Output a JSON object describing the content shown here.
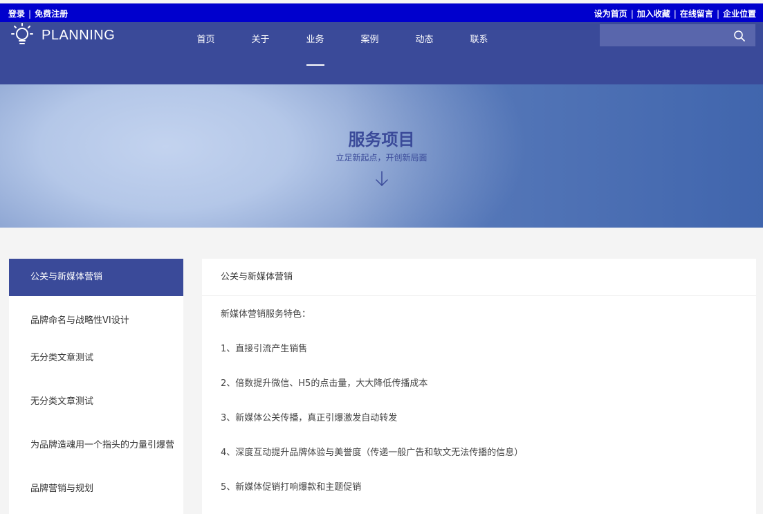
{
  "topbar": {
    "login": "登录",
    "register": "免费注册",
    "set_home": "设为首页",
    "add_fav": "加入收藏",
    "online_msg": "在线留言",
    "location": "企业位置",
    "separator": "|"
  },
  "header": {
    "logo_text": "PLANNING",
    "nav": [
      "首页",
      "关于",
      "业务",
      "案例",
      "动态",
      "联系"
    ],
    "active_nav": "业务",
    "search_placeholder": ""
  },
  "banner": {
    "title": "服务项目",
    "subtitle": "立足新起点，开创新局面"
  },
  "sidebar": {
    "items": [
      "公关与新媒体营销",
      "品牌命名与战略性VI设计",
      "无分类文章测试",
      "无分类文章测试",
      "为品牌造魂用一个指头的力量引爆营",
      "品牌营销与规划"
    ]
  },
  "content": {
    "title": "公关与新媒体营销",
    "lines": [
      "新媒体营销服务特色：",
      "1、直接引流产生销售",
      "2、倍数提升微信、H5的点击量，大大降低传播成本",
      "3、新媒体公关传播，真正引爆激发自动转发",
      "4、深度互动提升品牌体验与美誉度（传递一般广告和软文无法传播的信息）",
      "5、新媒体促销打响爆款和主题促销"
    ]
  },
  "colors": {
    "topbar_bg": "#0000cd",
    "header_bg": "#3a4a99",
    "accent": "#3a4a99"
  }
}
